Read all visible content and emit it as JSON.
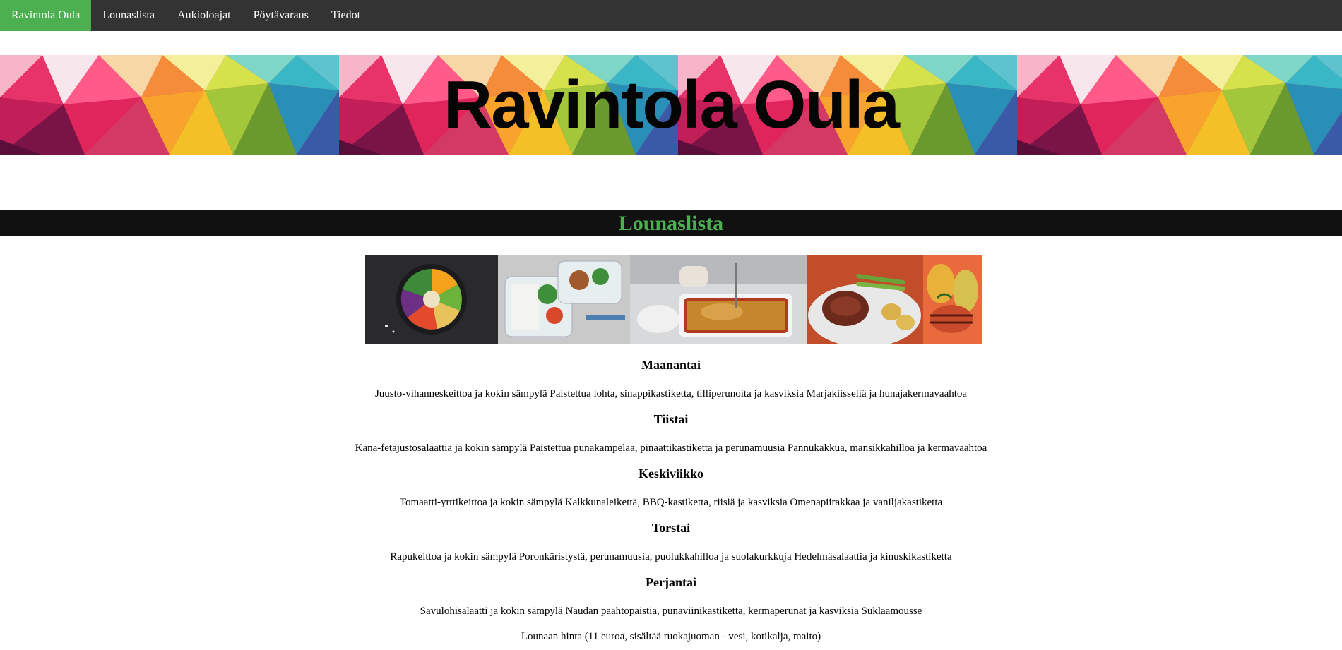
{
  "nav": {
    "brand": "Ravintola Oula",
    "items": [
      "Lounaslista",
      "Aukioloajat",
      "Pöytävaraus",
      "Tiedot"
    ]
  },
  "banner": {
    "title": "Ravintola Oula"
  },
  "section": {
    "title": "Lounaslista"
  },
  "colors": {
    "accent": "#4caf50",
    "nav_bg": "#333333",
    "bar_bg": "#111111"
  },
  "menu": {
    "days": [
      {
        "day": "Maanantai",
        "dishes": "Juusto-vihanneskeittoa ja kokin sämpylä Paistettua lohta, sinappikastiketta, tilliperunoita ja kasviksia Marjakiisseliä ja hunajakermavaahtoa"
      },
      {
        "day": "Tiistai",
        "dishes": "Kana-fetajustosalaattia ja kokin sämpylä Paistettua punakampelaa, pinaattikastiketta ja perunamuusia Pannukakkua, mansikkahilloa ja kermavaahtoa"
      },
      {
        "day": "Keskiviikko",
        "dishes": "Tomaatti-yrttikeittoa ja kokin sämpylä Kalkkunaleikettä, BBQ-kastiketta, riisiä ja kasviksia Omenapiirakkaa ja vaniljakastiketta"
      },
      {
        "day": "Torstai",
        "dishes": "Rapukeittoa ja kokin sämpylä Poronkäristystä, perunamuusia, puolukkahilloa ja suolakurkkuja Hedelmäsalaattia ja kinuskikastiketta"
      },
      {
        "day": "Perjantai",
        "dishes": "Savulohisalaatti ja kokin sämpylä Naudan paahtopaistia, punaviinikastiketta, kermaperunat ja kasviksia Suklaamousse"
      }
    ],
    "price": "Lounaan hinta (11 euroa, sisältää ruokajuoman - vesi, kotikalja, maito)"
  }
}
